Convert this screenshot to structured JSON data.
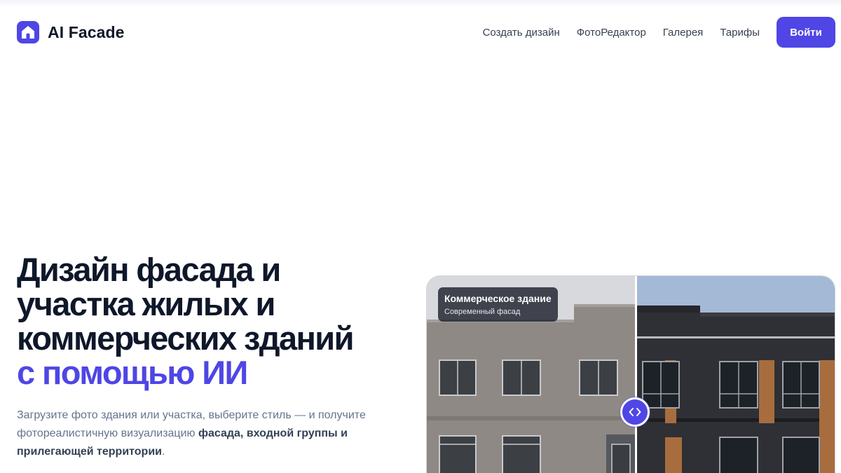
{
  "brand": {
    "name": "AI Facade",
    "logo_icon": "house-icon",
    "accent_color": "#4f46e5"
  },
  "nav": {
    "links": [
      "Создать дизайн",
      "ФотоРедактор",
      "Галерея",
      "Тарифы"
    ],
    "login_label": "Войти"
  },
  "hero": {
    "title_lines": [
      "Дизайн фасада и",
      "участка жилых и",
      "коммерческих зданий"
    ],
    "title_accent": "с помощью ИИ",
    "subtitle_plain": "Загрузите фото здания или участка, выберите стиль — и получите фотореалистичную визуализацию ",
    "subtitle_bold": "фасада, входной группы и прилегающей территории",
    "subtitle_end": "."
  },
  "comparison": {
    "caption_title": "Коммерческое здание",
    "caption_subtitle": "Современный фасад",
    "handle_icon": "chevron-left-right-icon",
    "slider_position": 0.5
  }
}
